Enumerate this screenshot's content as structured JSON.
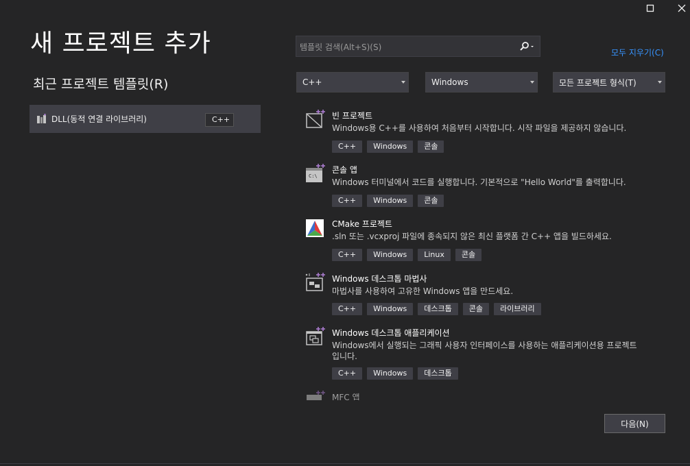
{
  "window": {
    "maximize_icon": "maximize-icon",
    "close_icon": "close-icon"
  },
  "header": {
    "title": "새 프로젝트 추가"
  },
  "recent": {
    "title": "최근 프로젝트 템플릿(R)",
    "items": [
      {
        "label": "DLL(동적 연결 라이브러리)",
        "tag": "C++",
        "icon": "dll-project-icon"
      }
    ]
  },
  "search": {
    "placeholder": "템플릿 검색(Alt+S)(S)",
    "value": ""
  },
  "clear_filters": "모두 지우기(C)",
  "filters": {
    "language": "C++",
    "platform": "Windows",
    "project_type": "모든 프로젝트 형식(T)"
  },
  "templates": [
    {
      "name": "빈 프로젝트",
      "description": "Windows용 C++를 사용하여 처음부터 시작합니다. 시작 파일을 제공하지 않습니다.",
      "tags": [
        "C++",
        "Windows",
        "콘솔"
      ],
      "icon": "empty-project-icon"
    },
    {
      "name": "콘솔 앱",
      "description": "Windows 터미널에서 코드를 실행합니다. 기본적으로 \"Hello World\"를 출력합니다.",
      "tags": [
        "C++",
        "Windows",
        "콘솔"
      ],
      "icon": "console-app-icon"
    },
    {
      "name": "CMake 프로젝트",
      "description": ".sln 또는 .vcxproj 파일에 종속되지 않은 최신 플랫폼 간 C++ 앱을 빌드하세요.",
      "tags": [
        "C++",
        "Windows",
        "Linux",
        "콘솔"
      ],
      "icon": "cmake-icon"
    },
    {
      "name": "Windows 데스크톱 마법사",
      "description": "마법사를 사용하여 고유한 Windows 앱을 만드세요.",
      "tags": [
        "C++",
        "Windows",
        "데스크톱",
        "콘솔",
        "라이브러리"
      ],
      "icon": "desktop-wizard-icon"
    },
    {
      "name": "Windows 데스크톱 애플리케이션",
      "description": "Windows에서 실행되는 그래픽 사용자 인터페이스를 사용하는 애플리케이션용 프로젝트입니다.",
      "tags": [
        "C++",
        "Windows",
        "데스크톱"
      ],
      "icon": "desktop-app-icon"
    },
    {
      "name": "MFC 앱",
      "description": "",
      "tags": [],
      "icon": "mfc-app-icon"
    }
  ],
  "footer": {
    "next_label": "다음(N)"
  }
}
